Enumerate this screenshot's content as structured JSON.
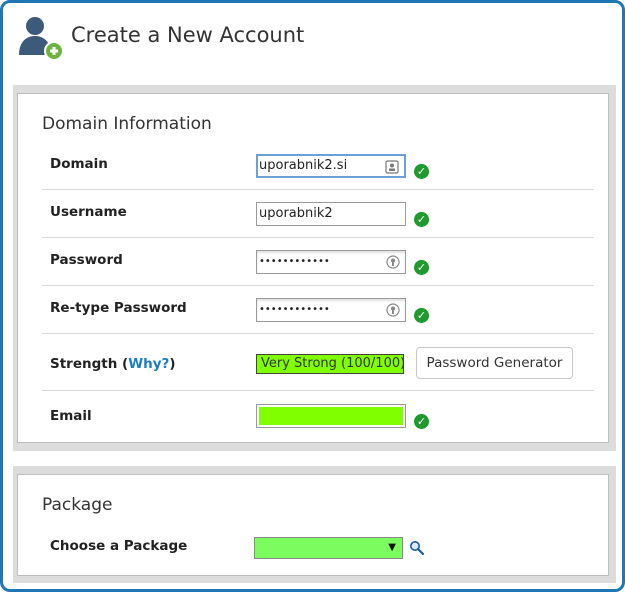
{
  "header": {
    "title": "Create a New Account",
    "icon": "user-add-icon"
  },
  "domain_section": {
    "title": "Domain Information",
    "domain": {
      "label": "Domain",
      "value": "uporabnik2.si"
    },
    "username": {
      "label": "Username",
      "value": "uporabnik2"
    },
    "password": {
      "label": "Password",
      "value": "••••••••••••"
    },
    "retype": {
      "label": "Re-type Password",
      "value": "••••••••••••"
    },
    "strength": {
      "label_prefix": "Strength (",
      "why_link": "Why?",
      "label_suffix": ")",
      "value": "Very Strong (100/100)",
      "generator_button": "Password Generator"
    },
    "email": {
      "label": "Email",
      "value": ""
    }
  },
  "package_section": {
    "title": "Package",
    "choose": {
      "label": "Choose a Package",
      "selected": ""
    }
  },
  "colors": {
    "accent": "#1f78b4",
    "ok_green": "#1f9a2e",
    "lime": "#80ff00",
    "link": "#1a7fc1"
  }
}
